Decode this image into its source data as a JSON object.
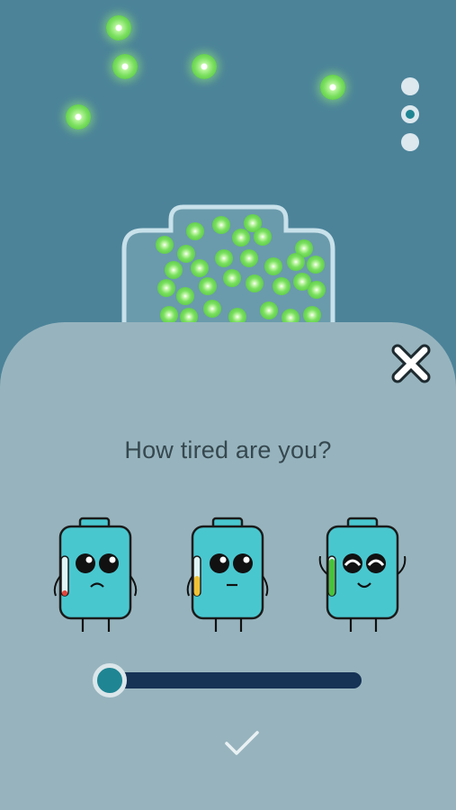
{
  "screen": {
    "question": "How tired are you?",
    "close_icon": "close-icon",
    "confirm_icon": "checkmark-icon"
  },
  "pager": {
    "count": 3,
    "active_index": 1
  },
  "tiredness_options": [
    {
      "name": "very-tired",
      "meter_color": "#e2453c",
      "meter_level": 0.15
    },
    {
      "name": "somewhat-tired",
      "meter_color": "#f1c232",
      "meter_level": 0.5
    },
    {
      "name": "not-tired",
      "meter_color": "#49c23d",
      "meter_level": 0.9
    }
  ],
  "slider": {
    "value": 0
  },
  "colors": {
    "background": "#4c8399",
    "sheet": "#97b4be",
    "battery_body": "#49c7cf",
    "accent": "#1f8593",
    "track": "#163255",
    "energy_orb": "#7be060"
  }
}
